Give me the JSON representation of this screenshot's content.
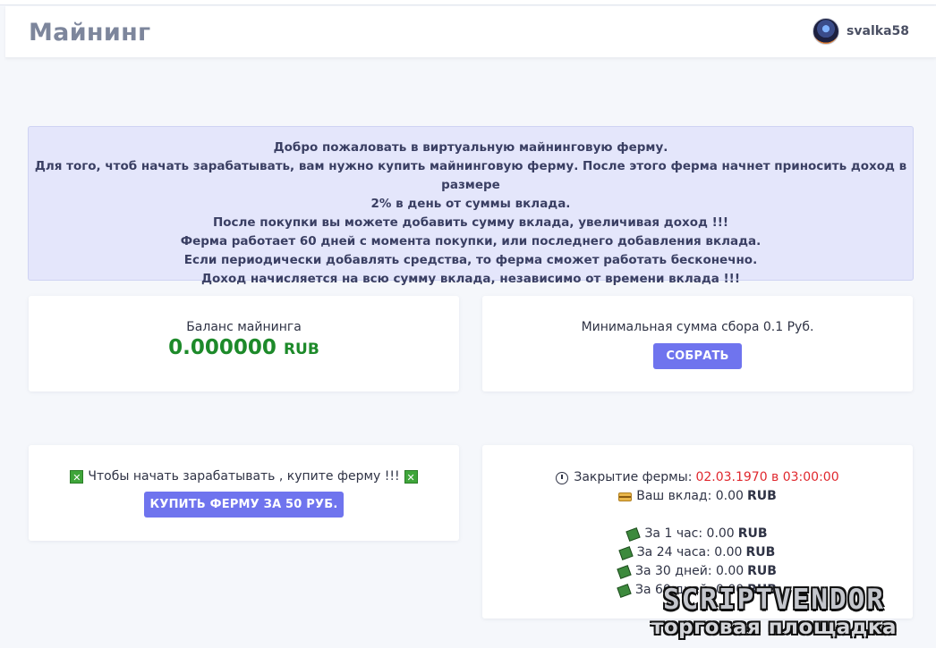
{
  "header": {
    "title": "Майнинг",
    "username": "svalka58"
  },
  "info": {
    "lines": [
      "Добро пожаловать в виртуальную майнинговую ферму.",
      "Для того, чтоб начать зарабатывать, вам нужно купить майнинговую ферму. После этого ферма начнет приносить доход в размере",
      "2% в день от суммы вклада.",
      "После покупки вы можете добавить сумму вклада, увеличивая доход !!!",
      "Ферма работает 60 дней с момента покупки, или последнего добавления вклада.",
      "Если периодически добавлять средства, то ферма сможет работать бесконечно.",
      "Доход начисляется на всю сумму вклада, независимо от времени вклада !!!"
    ]
  },
  "balance": {
    "label": "Баланс майнинга",
    "value": "0.000000",
    "currency": "RUB"
  },
  "collect": {
    "label": "Минимальная сумма сбора 0.1 Руб.",
    "button": "СОБРАТЬ"
  },
  "buy": {
    "label": "Чтобы начать зарабатывать , купите ферму !!!",
    "button": "КУПИТЬ ФЕРМУ ЗА 50 РУБ."
  },
  "stats": {
    "close_label": "Закрытие фермы:",
    "close_date": "02.03.1970 в 03:00:00",
    "deposit_label": "Ваш вклад: 0.00",
    "currency": "RUB",
    "rows": [
      {
        "label": "За 1 час: 0.00",
        "currency": "RUB"
      },
      {
        "label": "За 24 часа: 0.00",
        "currency": "RUB"
      },
      {
        "label": "За 30 дней: 0.00",
        "currency": "RUB"
      },
      {
        "label": "За 60 дней: 0.00",
        "currency": "RUB"
      }
    ]
  },
  "watermark": {
    "line1": "SCRIPTVENDOR",
    "line2": "торговая площадка"
  },
  "icons": {
    "avatar": "avatar",
    "buy_marks": "cross-mark-icon",
    "close": "clock-icon",
    "deposit": "credit-card-icon",
    "income": "money-icon"
  },
  "colors": {
    "accent": "#6f74ee",
    "balance": "#1d8a2a",
    "date": "#e0282e",
    "info_bg": "#e4e6fb"
  }
}
